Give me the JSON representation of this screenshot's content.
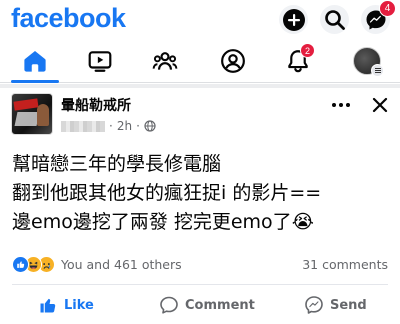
{
  "app": {
    "logo_text": "facebook",
    "brand_color": "#1877f2"
  },
  "topbar": {
    "icons": [
      "plus-icon",
      "search-icon",
      "messenger-icon"
    ],
    "messenger_badge": "4"
  },
  "tabs": {
    "items": [
      "home-icon",
      "video-icon",
      "groups-icon",
      "profile-icon",
      "notifications-icon",
      "menu-avatar"
    ],
    "active": "home",
    "notifications_badge": "2"
  },
  "post": {
    "page_name": "暈船勒戒所",
    "time": "2h",
    "privacy_icon": "globe-icon",
    "text_lines": [
      "幫暗戀三年的學長修電腦",
      "翻到他跟其他女的瘋狂捉i 的影片==",
      "邊emo邊挖了兩發 挖完更emo了"
    ],
    "emoji": "😭",
    "reaction_icons": [
      "like-reaction",
      "haha-reaction",
      "sad-reaction"
    ],
    "reactions_text": "You and 461 others",
    "comments_text": "31 comments"
  },
  "actions": {
    "like_label": "Like",
    "comment_label": "Comment",
    "send_label": "Send"
  }
}
